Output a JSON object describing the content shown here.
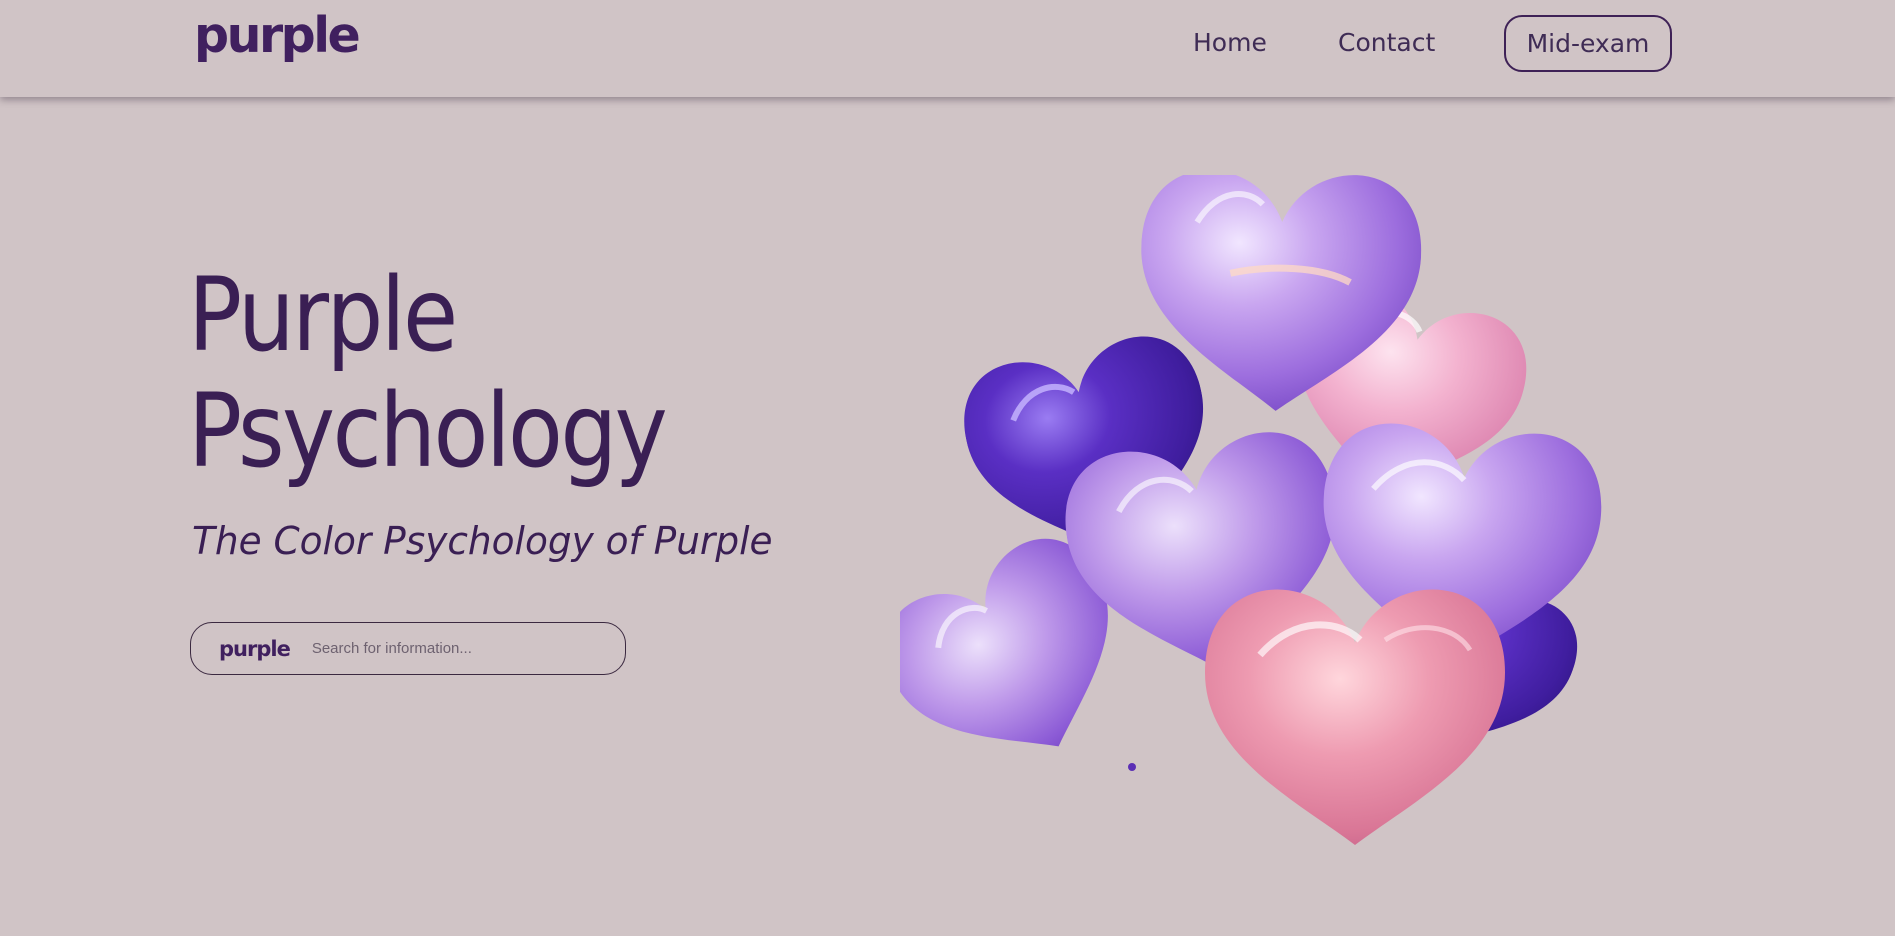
{
  "header": {
    "logo_text": "purple",
    "nav": {
      "home_label": "Home",
      "contact_label": "Contact",
      "cta_label": "Mid-exam"
    }
  },
  "hero": {
    "title_line1": "Purple",
    "title_line2": "Psychology",
    "subtitle": "The Color Psychology of Purple"
  },
  "search": {
    "logo_text": "purple",
    "placeholder": "Search for information..."
  },
  "illustration": {
    "subject": "heart-shaped foil balloons",
    "colors": [
      "#c9a6f0",
      "#5a2fc4",
      "#f0a9c7",
      "#b98ae8",
      "#e88aa6"
    ]
  },
  "theme": {
    "background": "#d0c4c6",
    "accent": "#40205f",
    "text": "#3a1f54"
  }
}
